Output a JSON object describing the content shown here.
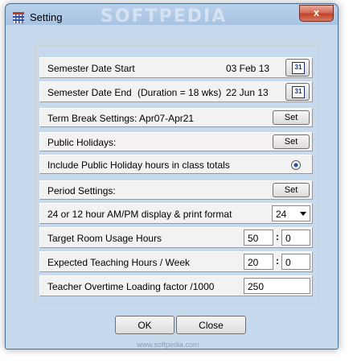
{
  "window": {
    "title": "Setting",
    "watermark": "SOFTPEDIA",
    "footer_watermark": "www.softpedia.com",
    "close_label": "x"
  },
  "rows": {
    "semester_start": {
      "label": "Semester Date Start",
      "value": "03 Feb 13",
      "calendar_icon_text": "31"
    },
    "semester_end": {
      "label": "Semester Date End",
      "duration": "(Duration = 18 wks)",
      "value": "22 Jun 13",
      "calendar_icon_text": "31"
    },
    "term_break": {
      "label": "Term Break Settings:  Apr07-Apr21",
      "button": "Set"
    },
    "public_holidays": {
      "label": "Public Holidays:",
      "button": "Set"
    },
    "include_holidays": {
      "label": "Include Public Holiday hours in class totals",
      "checked": true
    },
    "period_settings": {
      "label": "Period Settings:",
      "button": "Set"
    },
    "time_format": {
      "label": "24 or 12 hour AM/PM display & print format",
      "selected": "24"
    },
    "room_usage": {
      "label": "Target Room Usage Hours",
      "hours": "50",
      "minutes": "0"
    },
    "teaching_hours": {
      "label": "Expected Teaching Hours / Week",
      "hours": "20",
      "minutes": "0"
    },
    "overtime": {
      "label": "Teacher Overtime Loading factor /1000",
      "value": "250"
    }
  },
  "buttons": {
    "ok": "OK",
    "close": "Close"
  },
  "colors": {
    "title_bar": "#b9d1ea",
    "close_button": "#c1432b",
    "dialog_bg": "#f0f0f0",
    "calendar_blue": "#1a2f8a"
  },
  "icons": {
    "app": "grid-app-icon",
    "calendar": "calendar-icon",
    "close": "close-icon",
    "dropdown": "chevron-down-icon"
  }
}
